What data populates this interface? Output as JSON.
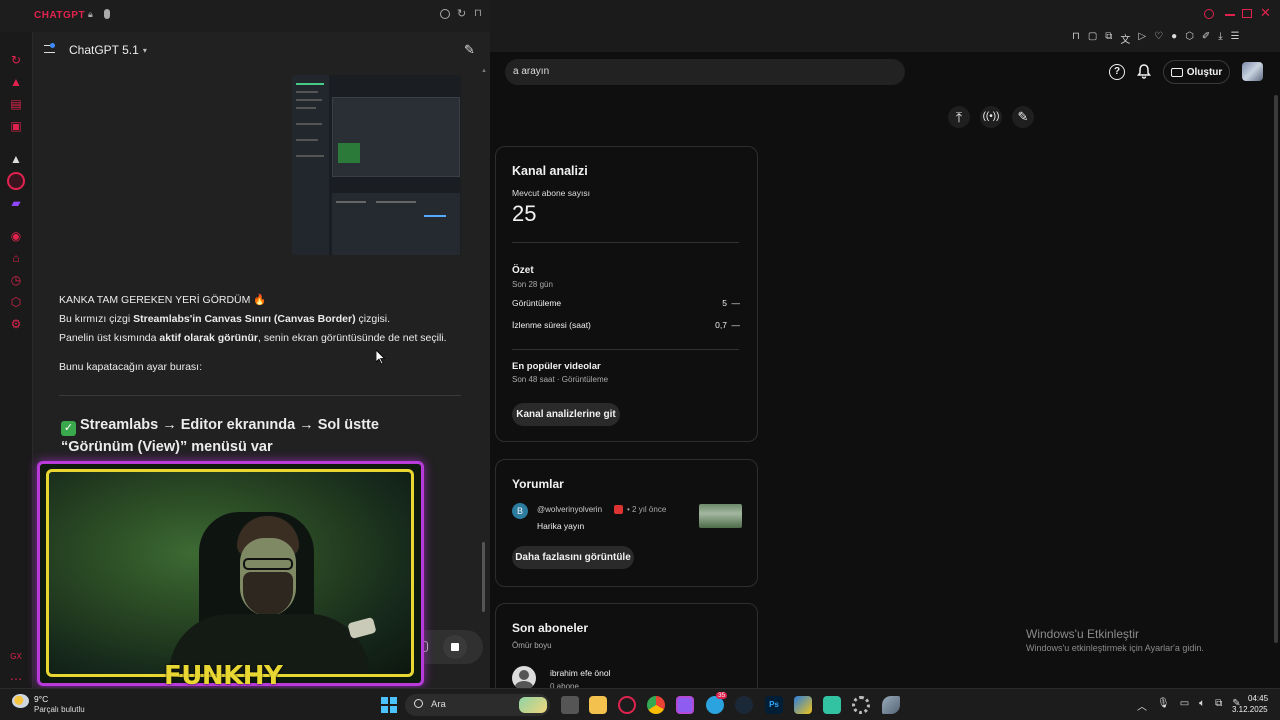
{
  "browser": {
    "title": "CHATGPT",
    "accent": "#e0234e"
  },
  "chatgpt": {
    "model_label": "ChatGPT 5.1",
    "messages": {
      "line1": "KANKA TAM GEREKEN YERİ GÖRDÜM 🔥",
      "line2_pre": "Bu kırmızı çizgi ",
      "line2_bold": "Streamlabs'in Canvas Sınırı (Canvas Border)",
      "line2_post": " çizgisi.",
      "line3_pre": "Panelin üst kısmında ",
      "line3_bold": "aktif olarak görünür",
      "line3_post": ", senin ekran görüntüsünde de net seçili.",
      "line4": "Bunu kapatacağın ayar burası:",
      "heading_check": "✅",
      "heading": "Streamlabs → Editor ekranında → Sol üstte “Görünüm (View)” menüsü var"
    }
  },
  "webcam": {
    "overlay_text": "FUNKHY"
  },
  "youtube": {
    "search_placeholder": "a arayın",
    "create_label": "Oluştur",
    "channel_analytics": {
      "title": "Kanal analizi",
      "subscribers_label": "Mevcut abone sayısı",
      "subscribers_value": "25",
      "summary_title": "Özet",
      "summary_period": "Son 28 gün",
      "rows": [
        {
          "label": "Görüntüleme",
          "value": "5",
          "trend": "—"
        },
        {
          "label": "İzlenme süresi (saat)",
          "value": "0,7",
          "trend": "—"
        }
      ],
      "popular_title": "En popüler videolar",
      "popular_period": "Son 48 saat · Görüntüleme",
      "button": "Kanal analizlerine git"
    },
    "comments": {
      "title": "Yorumlar",
      "author": "@wolverinyolverin",
      "time": "• 2 yıl önce",
      "avatar_letter": "B",
      "text": "Harika yayın",
      "button": "Daha fazlasını görüntüle"
    },
    "subscribers": {
      "title": "Son aboneler",
      "period": "Ömür boyu",
      "name": "ibrahim efe önol",
      "count": "0 abone"
    }
  },
  "watermark": {
    "title": "Windows'u Etkinleştir",
    "subtitle": "Windows'u etkinleştirmek için Ayarlar'a gidin."
  },
  "taskbar": {
    "weather_temp": "9°C",
    "weather_desc": "Parçalı bulutlu",
    "search_label": "Ara",
    "telegram_badge": "35",
    "time": "04:45",
    "date": "3.12.2025"
  }
}
